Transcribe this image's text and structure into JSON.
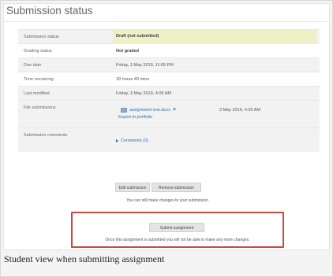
{
  "page": {
    "heading": "Submission status",
    "caption": "Student view when submitting assignment"
  },
  "table": {
    "rows": [
      {
        "label": "Submission status",
        "value": "Draft (not submitted)"
      },
      {
        "label": "Grading status",
        "value": "Not graded"
      },
      {
        "label": "Due date",
        "value": "Friday, 3 May 2019, 11:05 PM"
      },
      {
        "label": "Time remaining",
        "value": "18 hours 40 mins"
      },
      {
        "label": "Last modified",
        "value": "Friday, 3 May 2019, 4:05 AM"
      },
      {
        "label": "File submissions",
        "file_name": "assignment one.docx",
        "file_date": "3 May 2019, 4:05 AM",
        "export_link": "Export to portfolio"
      },
      {
        "label": "Submission comments",
        "comments_link": "Comments (0)"
      }
    ]
  },
  "actions": {
    "edit_label": "Edit submission",
    "remove_label": "Remove submission",
    "edit_note": "You can still make changes to your submission"
  },
  "submit": {
    "button_label": "Submit assignment",
    "note": "Once this assignment is submitted you will not be able to make any more changes."
  },
  "colors": {
    "status_highlight": "#eef0c6",
    "link": "#2a6fb3",
    "submit_box_border": "#c74a3f"
  },
  "icons": {
    "file": "file-icon",
    "add": "plus-icon",
    "expand": "triangle-right-icon"
  }
}
